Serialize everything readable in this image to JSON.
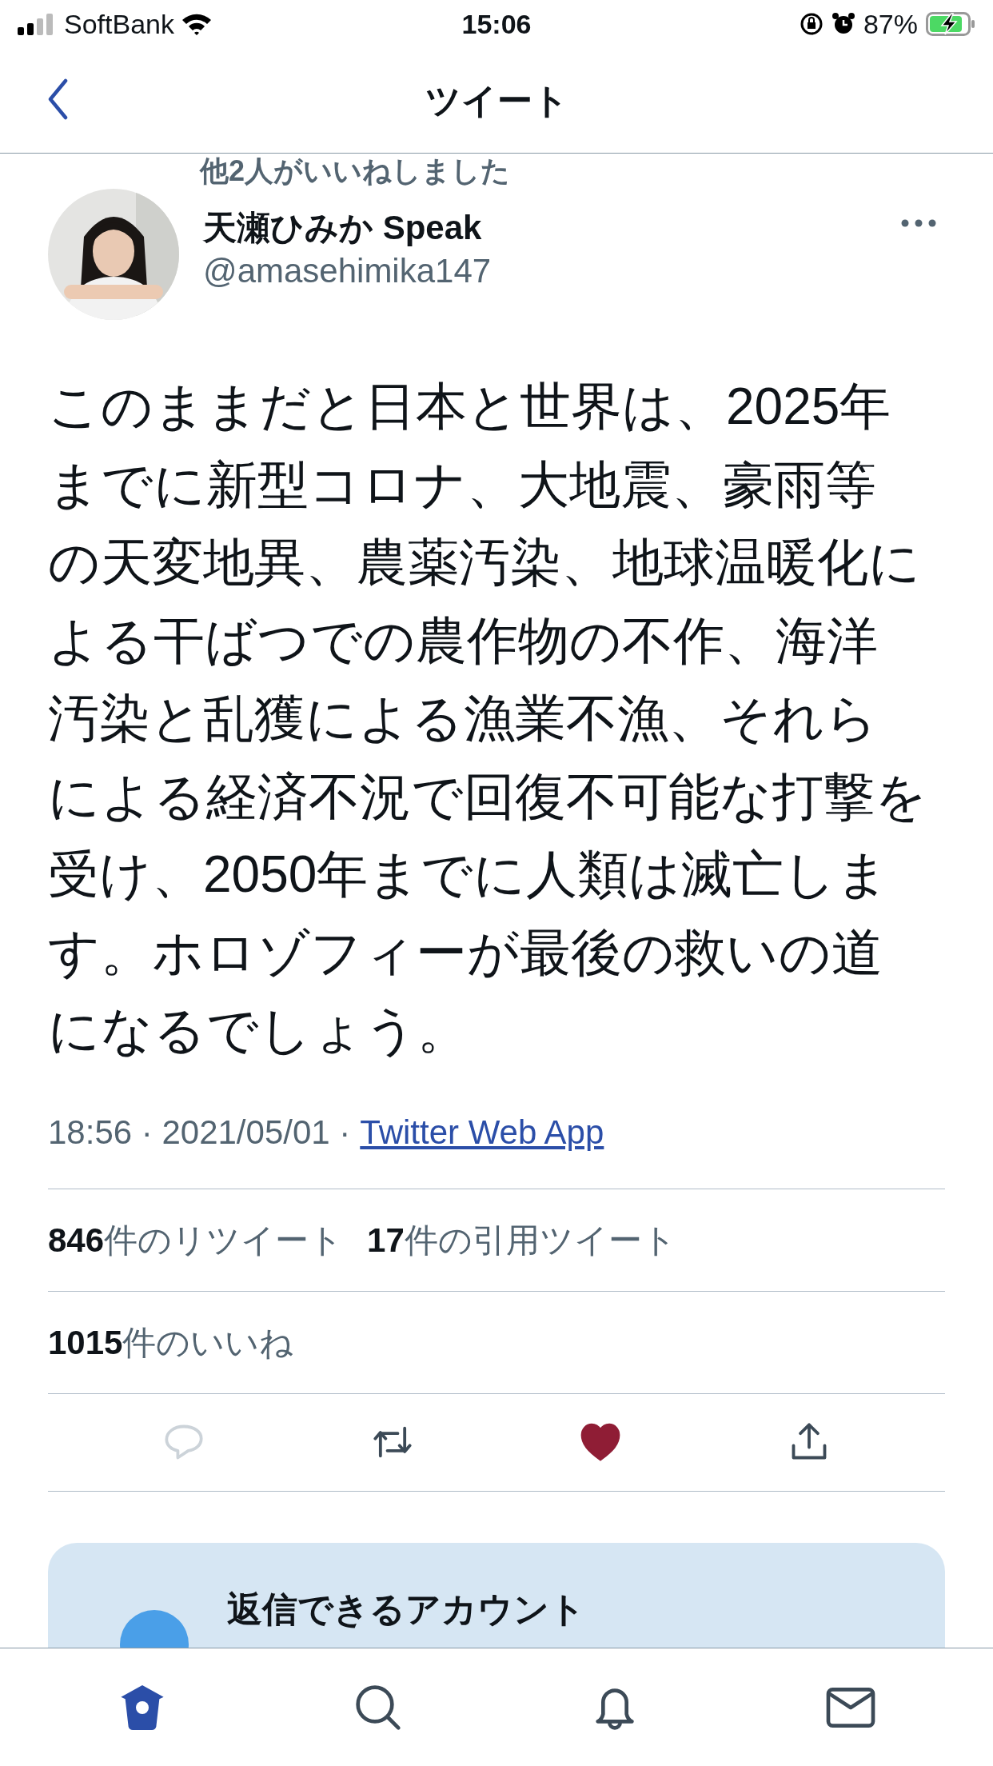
{
  "status_bar": {
    "carrier": "SoftBank",
    "time": "15:06",
    "battery": "87%",
    "charging": true
  },
  "header": {
    "title": "ツイート"
  },
  "social_context": "他2人がいいねしました",
  "tweet": {
    "author_name": "天瀬ひみか Speak",
    "handle": "@amasehimika147",
    "text": "このままだと日本と世界は、2025年までに新型コロナ、大地震、豪雨等の天変地異、農薬汚染、地球温暖化による干ばつでの農作物の不作、海洋汚染と乱獲による漁業不漁、それらによる経済不況で回復不可能な打撃を受け、2050年までに人類は滅亡します。ホロゾフィーが最後の救いの道になるでしょう。",
    "timestamp": "18:56 · 2021/05/01 ·",
    "source": "Twitter Web App"
  },
  "stats": [
    {
      "count": "846",
      "label": "件のリツイート"
    },
    {
      "count": "17",
      "label": "件の引用ツイート"
    }
  ],
  "likes": {
    "count": "1015",
    "label": "件のいいね"
  },
  "actions": [
    {
      "kind": "reply",
      "active": false
    },
    {
      "kind": "retweet",
      "active": false
    },
    {
      "kind": "like",
      "active": true
    },
    {
      "kind": "share",
      "active": false
    }
  ],
  "reply_card": {
    "title": "返信できるアカウント"
  },
  "tab_bar": [
    {
      "kind": "home",
      "selected": true
    },
    {
      "kind": "search",
      "selected": false
    },
    {
      "kind": "notifications",
      "selected": false
    },
    {
      "kind": "messages",
      "selected": false
    }
  ]
}
